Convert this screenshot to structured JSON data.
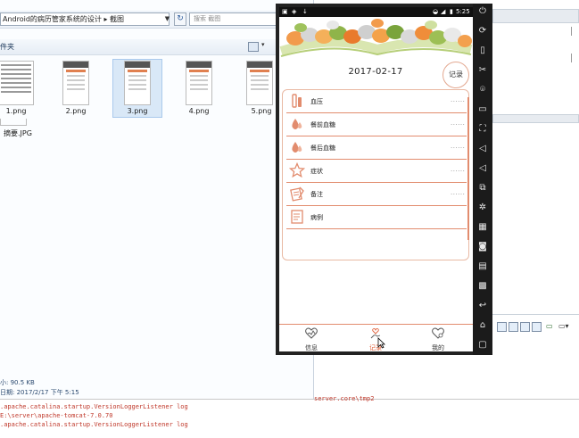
{
  "explorer": {
    "address_path": "Android的病历管家系统的设计 ▸ 截图",
    "search_placeholder": "搜索 截图",
    "command_label": "件夹",
    "files": [
      {
        "name": "1.png"
      },
      {
        "name": "2.png"
      },
      {
        "name": "3.png"
      },
      {
        "name": "4.png"
      },
      {
        "name": "5.png"
      }
    ],
    "extra_file": "摘要.JPG",
    "status_size": "小: 90.5 KB",
    "status_date": "日期: 2017/2/17 下午 5:15"
  },
  "console": {
    "lines": [
      ".apache.catalina.startup.VersionLoggerListener log",
      "    E:\\server\\apache-tomcat-7.0.70",
      ".apache.catalina.startup.VersionLoggerListener log"
    ],
    "server_path": "server.core\\tmp2"
  },
  "phone": {
    "status_time": "5:25",
    "date": "2017-02-17",
    "record_button": "记录",
    "rows": [
      {
        "label": "血压",
        "value": "......",
        "icon": "blood-pressure-icon"
      },
      {
        "label": "餐前血糖",
        "value": "......",
        "icon": "blood-drop-icon"
      },
      {
        "label": "餐后血糖",
        "value": "......",
        "icon": "blood-drop-icon"
      },
      {
        "label": "症状",
        "value": "......",
        "icon": "star-icon"
      },
      {
        "label": "备注",
        "value": "......",
        "icon": "note-icon"
      },
      {
        "label": "病例",
        "value": "",
        "icon": "case-book-icon"
      }
    ],
    "tabs": [
      {
        "label": "信息",
        "icon": "heart-info-icon"
      },
      {
        "label": "记录",
        "icon": "hand-heart-icon"
      },
      {
        "label": "我的",
        "icon": "heart-user-icon"
      }
    ]
  },
  "colors": {
    "accent": "#e28c6e",
    "active_tab": "#e0603a",
    "status_bar": "#111111"
  }
}
